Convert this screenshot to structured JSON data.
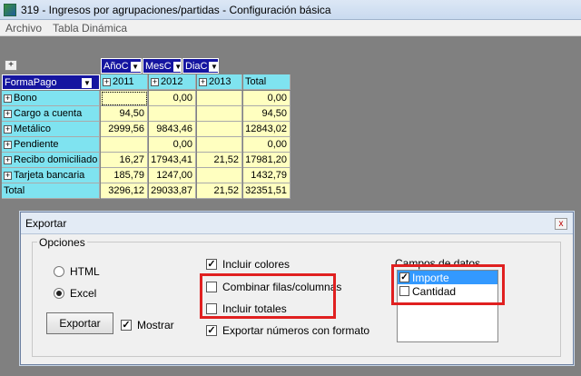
{
  "window": {
    "title": "319 - Ingresos por agrupaciones/partidas - Configuración básica"
  },
  "menu": [
    "Archivo",
    "Tabla Dinámica"
  ],
  "pivot": {
    "corner": "+",
    "col_fields": [
      "AñoC",
      "MesC",
      "DiaC"
    ],
    "row_field": "FormaPago",
    "years": [
      "2011",
      "2012",
      "2013"
    ],
    "total_label": "Total",
    "rows": [
      {
        "label": "Bono",
        "expand": true,
        "v": [
          "",
          "0,00",
          "",
          "0,00"
        ]
      },
      {
        "label": "Cargo a cuenta",
        "expand": true,
        "v": [
          "94,50",
          "",
          "",
          "94,50"
        ]
      },
      {
        "label": "Metálico",
        "expand": true,
        "v": [
          "2999,56",
          "9843,46",
          "",
          "12843,02"
        ]
      },
      {
        "label": "Pendiente",
        "expand": true,
        "v": [
          "",
          "0,00",
          "",
          "0,00"
        ]
      },
      {
        "label": "Recibo domiciliado",
        "expand": true,
        "v": [
          "16,27",
          "17943,41",
          "21,52",
          "17981,20"
        ]
      },
      {
        "label": "Tarjeta bancaria",
        "expand": true,
        "v": [
          "185,79",
          "1247,00",
          "",
          "1432,79"
        ]
      },
      {
        "label": "Total",
        "expand": false,
        "v": [
          "3296,12",
          "29033,87",
          "21,52",
          "32351,51"
        ]
      }
    ]
  },
  "dialog": {
    "title": "Exportar",
    "close": "x",
    "options_label": "Opciones",
    "radio_html": "HTML",
    "radio_excel": "Excel",
    "export_button": "Exportar",
    "show_label": "Mostrar",
    "include_colors": "Incluir colores",
    "combine": "Combinar filas/columnas",
    "include_totals": "Incluir totales",
    "export_format": "Exportar números con formato",
    "fields_label": "Campos de datos",
    "fields": [
      {
        "label": "Importe",
        "checked": true,
        "selected": true
      },
      {
        "label": "Cantidad",
        "checked": false,
        "selected": false
      }
    ],
    "check_mark": "✓"
  }
}
